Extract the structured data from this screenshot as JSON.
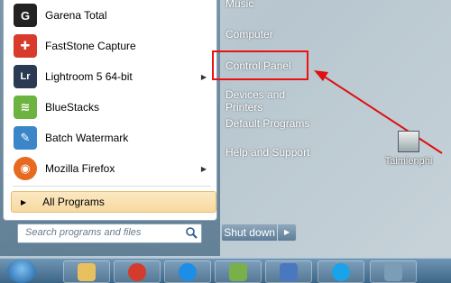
{
  "start_menu": {
    "programs": [
      {
        "label": "Garena Total",
        "icon": "garena-icon",
        "color": "#222222",
        "glyph": "G",
        "arrow": false
      },
      {
        "label": "FastStone Capture",
        "icon": "faststone-icon",
        "color": "#d83a2c",
        "glyph": "✚",
        "arrow": false
      },
      {
        "label": "Lightroom 5 64-bit",
        "icon": "lightroom-icon",
        "color": "#2a3a52",
        "glyph": "Lr",
        "arrow": true
      },
      {
        "label": "BlueStacks",
        "icon": "bluestacks-icon",
        "color": "#6db33f",
        "glyph": "≋",
        "arrow": false
      },
      {
        "label": "Batch Watermark",
        "icon": "watermark-icon",
        "color": "#3b86c9",
        "glyph": "✎",
        "arrow": false
      },
      {
        "label": "Mozilla Firefox",
        "icon": "firefox-icon",
        "color": "#e66a1f",
        "glyph": "◉",
        "arrow": true
      }
    ],
    "all_programs": "All Programs",
    "search_placeholder": "Search programs and files",
    "right_items": {
      "music": "Music",
      "computer": "Computer",
      "control_panel": "Control Panel",
      "devices": "Devices and Printers",
      "default_programs": "Default Programs",
      "help": "Help and Support"
    },
    "shutdown": "Shut down"
  },
  "desktop_icon": {
    "label": "Taimienphi"
  },
  "taskbar": {
    "items": [
      {
        "icon": "file-explorer-icon",
        "color": "#e8c060"
      },
      {
        "icon": "chrome-icon",
        "color": "#d33b2c"
      },
      {
        "icon": "zalo-icon",
        "color": "#1c8ee8"
      },
      {
        "icon": "paint-icon",
        "color": "#7ab04a"
      },
      {
        "icon": "document-icon",
        "color": "#4a78c0"
      },
      {
        "icon": "skype-icon",
        "color": "#1aa3e8"
      },
      {
        "icon": "photo-viewer-icon",
        "color": "#7c9db6"
      }
    ]
  },
  "colors": {
    "highlight_border": "#ee1111",
    "arrow": "#dd1111"
  }
}
